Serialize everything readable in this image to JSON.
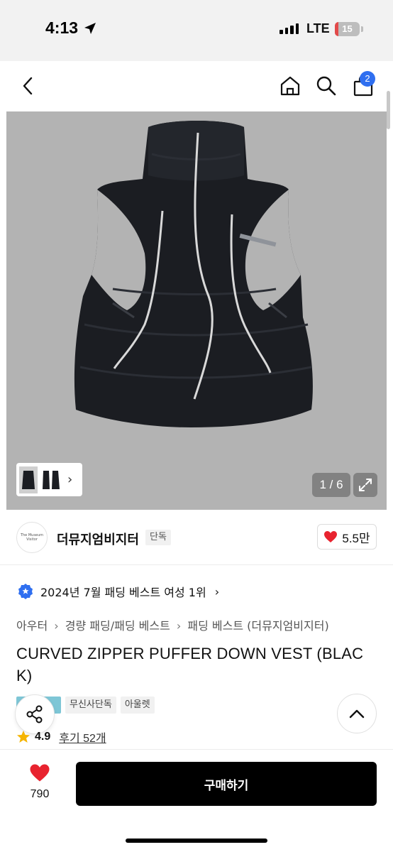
{
  "status_bar": {
    "time": "4:13",
    "network": "LTE",
    "battery": "15"
  },
  "header": {
    "cart_count": "2",
    "icons": [
      "back-icon",
      "home-icon",
      "search-icon",
      "cart-icon"
    ]
  },
  "gallery": {
    "counter": "1 / 6",
    "background": "#b3b3b3"
  },
  "brand": {
    "logo_text": "The Museum Visitor",
    "name": "더뮤지엄비지터",
    "exclusive_label": "단독",
    "likes": "5.5만"
  },
  "award": {
    "text": "2024년 7월 패딩 베스트 여성 1위"
  },
  "breadcrumb": [
    "아우터",
    "경량 패딩/패딩 베스트",
    "패딩 베스트 (더뮤지엄비지터)"
  ],
  "product": {
    "title": "CURVED ZIPPER PUFFER DOWN VEST (BLACK)",
    "tags": [
      "",
      "무신사단독",
      "아울렛"
    ],
    "rating": "4.9",
    "review_link": "후기 52개"
  },
  "bottom": {
    "wish_count": "790",
    "buy_label": "구매하기"
  },
  "colors": {
    "heart": "#e8232f",
    "badge": "#2f6ff0",
    "buy_button": "#000000",
    "award_badge": "#2f6ff0",
    "star": "#f5b400"
  }
}
